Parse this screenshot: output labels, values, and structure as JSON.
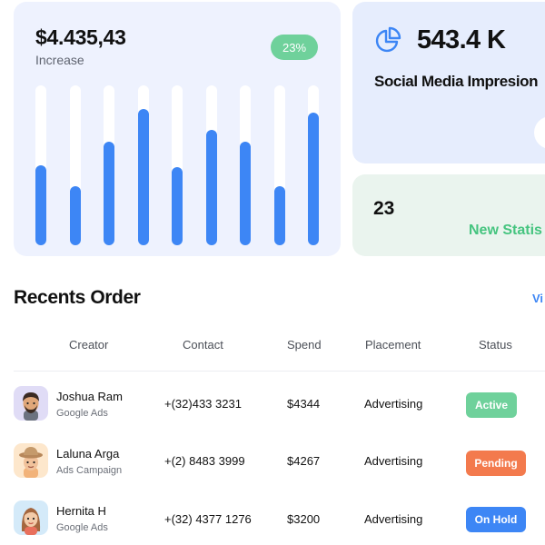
{
  "revenue": {
    "amount": "$4.435,43",
    "label": "Increase",
    "change_badge": "23%",
    "bars": [
      {
        "fill": 0.5
      },
      {
        "fill": 0.37
      },
      {
        "fill": 0.65
      },
      {
        "fill": 0.85
      },
      {
        "fill": 0.49
      },
      {
        "fill": 0.72
      },
      {
        "fill": 0.65
      },
      {
        "fill": 0.37
      },
      {
        "fill": 0.83
      }
    ],
    "colors": {
      "card": "#eef2fe",
      "track": "#ffffff",
      "fill": "#3d86f5",
      "badge": "#6fd19b"
    }
  },
  "social": {
    "icon": "pie-chart-icon",
    "value": "543.4 K",
    "label": "Social Media Impresion",
    "colors": {
      "card": "#e6edfd",
      "icon": "#3d86f5"
    }
  },
  "stats": {
    "value": "23",
    "label": "New Statis",
    "colors": {
      "card": "#eaf4ee",
      "label": "#45c47f"
    }
  },
  "orders": {
    "title": "Recents Order",
    "view_link": "Vi",
    "columns": [
      "Creator",
      "Contact",
      "Spend",
      "Placement",
      "Status"
    ],
    "rows": [
      {
        "name": "Joshua Ram",
        "source": "Google Ads",
        "contact": "+(32)433 3231",
        "spend": "$4344",
        "placement": "Advertising",
        "status": "Active",
        "status_color": "#6fd19b",
        "avatar": "man-avatar-icon",
        "avatar_bg": "#e0dcf6"
      },
      {
        "name": "Laluna Arga",
        "source": "Ads Campaign",
        "contact": "+(2) 8483 3999",
        "spend": "$4267",
        "placement": "Advertising",
        "status": "Pending",
        "status_color": "#f37a4d",
        "avatar": "woman-hat-avatar-icon",
        "avatar_bg": "#fde7cc"
      },
      {
        "name": "Hernita H",
        "source": "Google Ads",
        "contact": "+(32) 4377 1276",
        "spend": "$3200",
        "placement": "Advertising",
        "status": "On Hold",
        "status_color": "#3d86f5",
        "avatar": "woman-avatar-icon",
        "avatar_bg": "#d4eaf9"
      }
    ]
  }
}
